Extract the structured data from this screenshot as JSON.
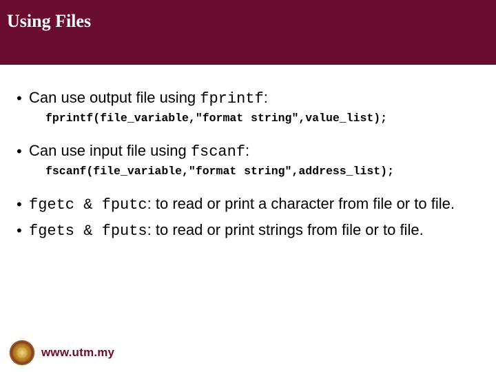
{
  "title": "Using Files",
  "bullets": [
    {
      "pre": "Can use output file using ",
      "mono": "fprintf",
      "post": ":"
    },
    {
      "codeline": "fprintf(file_variable,\"format string\",value_list);"
    },
    {
      "pre": "Can use input file using ",
      "mono": "fscanf",
      "post": ":"
    },
    {
      "codeline": "fscanf(file_variable,\"format string\",address_list);"
    },
    {
      "mono_first": "fgetc & fputc",
      "rest": ": to read or print a character from file or to file."
    },
    {
      "mono_first": "fgets & fputs",
      "rest": ": to read or print strings from file or to file."
    }
  ],
  "footer": {
    "url": "www.utm.my"
  },
  "colors": {
    "brand": "#6a0c2f"
  }
}
